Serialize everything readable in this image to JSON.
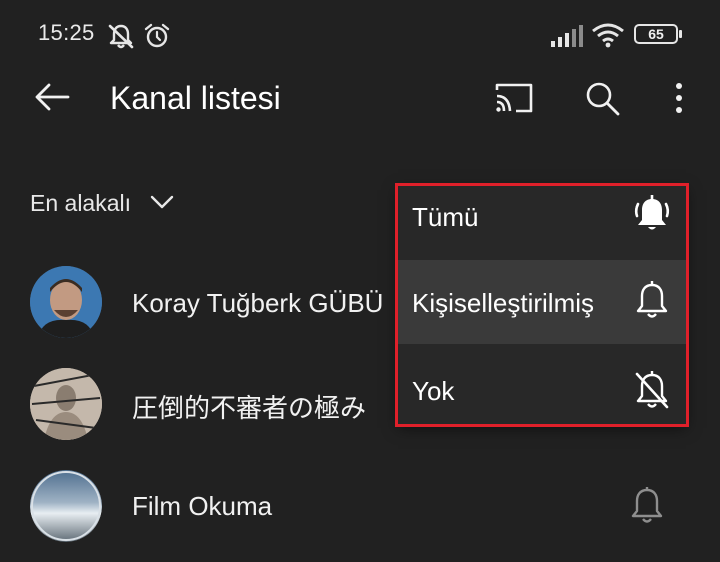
{
  "status_bar": {
    "time": "15:25",
    "battery": "65",
    "icons": [
      "mute-notifications-icon",
      "alarm-icon",
      "signal-icon",
      "wifi-icon",
      "battery-icon"
    ]
  },
  "header": {
    "title": "Kanal listesi",
    "icons": [
      "back-arrow-icon",
      "cast-icon",
      "search-icon",
      "more-vertical-icon"
    ]
  },
  "sort": {
    "label": "En alakalı"
  },
  "channels": [
    {
      "name": "Koray Tuğberk GÜBÜ"
    },
    {
      "name": "圧倒的不審者の極み"
    },
    {
      "name": "Film Okuma",
      "notification_icon": "bell-outline-icon"
    }
  ],
  "notification_menu": {
    "items": [
      {
        "label": "Tümü",
        "icon": "bell-ringing-filled-icon"
      },
      {
        "label": "Kişiselleştirilmiş",
        "icon": "bell-outline-icon",
        "selected": true
      },
      {
        "label": "Yok",
        "icon": "bell-off-icon"
      }
    ],
    "highlight_color": "#e0202a"
  },
  "colors": {
    "background": "#212121",
    "menu_background": "#282828",
    "menu_selected": "#3a3a3a",
    "text": "#f1f1f1"
  }
}
